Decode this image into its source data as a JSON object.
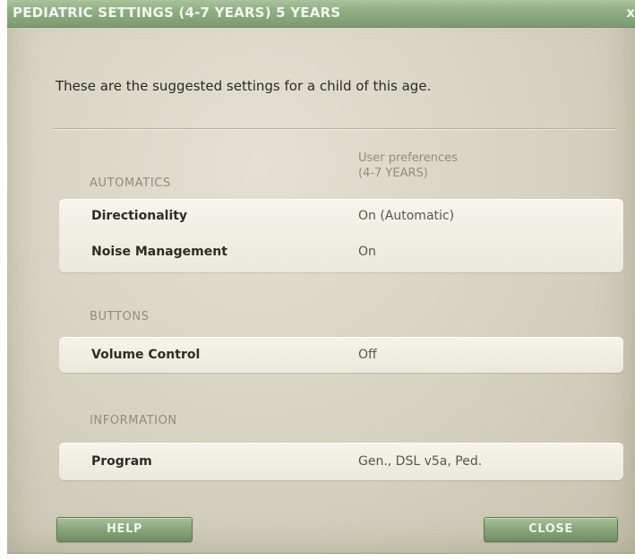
{
  "window": {
    "title": "PEDIATRIC SETTINGS (4-7 YEARS) 5 YEARS",
    "close_glyph": "x"
  },
  "intro_text": "These are the suggested settings for a child of this age.",
  "column_header": {
    "line1": "User preferences",
    "line2": "(4-7 YEARS)"
  },
  "sections": {
    "automatics": {
      "label": "AUTOMATICS",
      "rows": [
        {
          "name": "Directionality",
          "value": "On (Automatic)"
        },
        {
          "name": "Noise Management",
          "value": "On"
        }
      ]
    },
    "buttons": {
      "label": "BUTTONS",
      "rows": [
        {
          "name": "Volume Control",
          "value": "Off"
        }
      ]
    },
    "information": {
      "label": "INFORMATION",
      "rows": [
        {
          "name": "Program",
          "value": "Gen., DSL v5a, Ped."
        }
      ]
    }
  },
  "footer": {
    "help_label": "HELP",
    "close_label": "CLOSE"
  }
}
